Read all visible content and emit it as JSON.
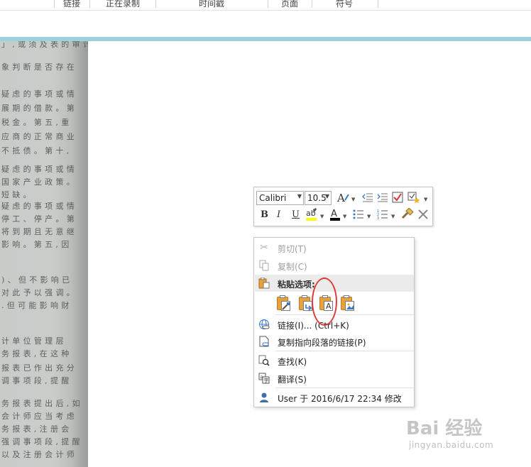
{
  "ribbon": {
    "groups": [
      "链接",
      "正在录制",
      "时间戳",
      "页面",
      "符号"
    ]
  },
  "document": {
    "lines": [
      "」 , 或 须 及 表 的 审 计 意",
      "象 判 断 是 否 存 在",
      "疑 虑 的 事 项 或 情",
      "展 期 的 借 款 。 第",
      "税 金 。 第 五 , 重",
      "应 商 的 正 常 商 业",
      "不 抵 债 。 第 十 ,",
      "疑 虑 的 事 项 或 情",
      "国 家 产 业 政 策 。",
      "短 缺 。",
      "疑 虑 的 事 项 或 情",
      "停 工 、 停 产 。 第",
      "将 到 期 且 无 意 继",
      "影 响 。 第 五 , 因",
      ") 、 但 不 影 响 已",
      "对 此 予 以 强 调 。",
      ". 但 可 能 影 响 财",
      "计 单 位 管 理 层",
      "务 报 表 , 在 这 种",
      "报 表 已 作 出 充 分",
      "调 事 项 段 , 提 醒",
      "务 报 表 提 出 后 , 如",
      "会 计 师 应 当 考 虑",
      "务 报 表 , 注 册 会",
      "强 调 事 项 段 , 提 醒",
      "以 及 注 册 会 计 师"
    ]
  },
  "mini_toolbar": {
    "font_name": "Calibri",
    "font_size": "10.5",
    "bold": "B",
    "italic": "I",
    "underline": "U",
    "font_color_glyph": "A",
    "highlight_color": "#ffff00",
    "font_color": "#000000"
  },
  "context_menu": {
    "cut": "剪切(T)",
    "copy": "复制(C)",
    "paste_header": "粘贴选项:",
    "link": "链接(I)...  (Ctrl+K)",
    "copy_link": "复制指向段落的链接(P)",
    "find": "查找(K)",
    "translate": "翻译(S)",
    "modified_by": "User 于 2016/6/17 22:34 修改"
  },
  "paste_options": [
    "keep-source-formatting",
    "merge-formatting",
    "keep-text-only",
    "picture"
  ],
  "colors": {
    "accent_bar": "#9dd1df",
    "highlight_ring": "#e23a3a",
    "clipboard": "#e8a23d"
  },
  "watermark": {
    "logo": "Bai 经验",
    "url": "jingyan.baidu.com"
  }
}
